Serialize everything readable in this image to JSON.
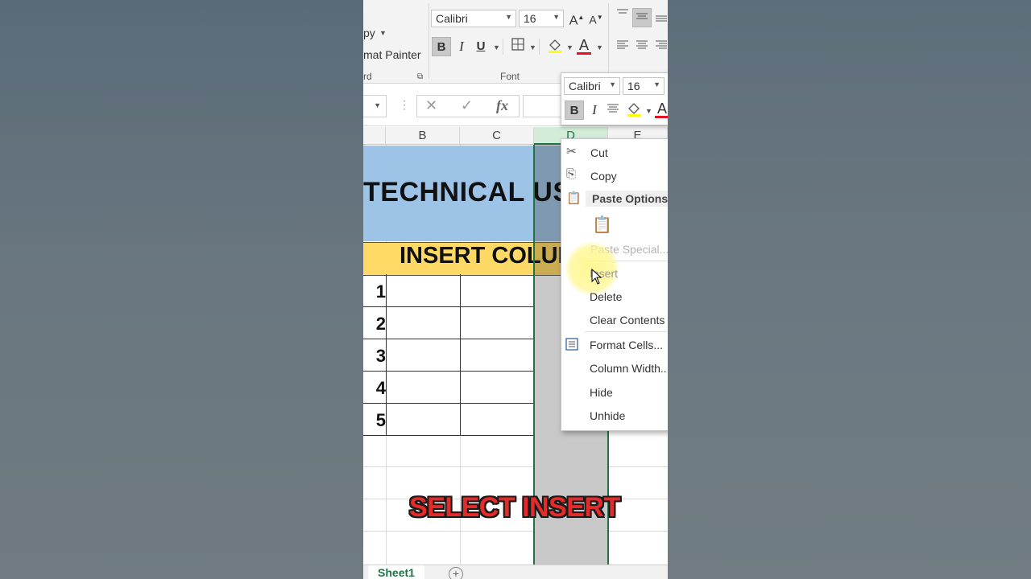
{
  "ribbon": {
    "clipboard": {
      "copy_label": "py",
      "format_painter_label": "mat Painter",
      "group_label": "rd"
    },
    "font": {
      "font_name": "Calibri",
      "font_size": "16",
      "grow_font": "A",
      "shrink_font": "A",
      "bold": "B",
      "italic": "I",
      "underline": "U",
      "font_color": "A",
      "group_label": "Font"
    }
  },
  "formula_bar": {
    "cancel": "✕",
    "enter": "✓",
    "fx": "fx"
  },
  "columns": [
    "B",
    "C",
    "D",
    "E"
  ],
  "sheet": {
    "title": "TECHNICAL US",
    "subtitle": "INSERT COLUM",
    "row_numbers": [
      "1",
      "2",
      "3",
      "4",
      "5"
    ]
  },
  "mini_toolbar": {
    "font_name": "Calibri",
    "font_size": "16",
    "bold": "B",
    "italic": "I",
    "font_color": "A"
  },
  "context_menu": {
    "cut": "Cut",
    "copy": "Copy",
    "paste_options": "Paste Options:",
    "paste_special": "Paste Special...",
    "insert": "Insert",
    "delete": "Delete",
    "clear_contents": "Clear Contents",
    "format_cells": "Format Cells...",
    "column_width": "Column Width...",
    "hide": "Hide",
    "unhide": "Unhide"
  },
  "sheet_tab": "Sheet1",
  "caption": "SELECT INSERT",
  "colors": {
    "excel_green": "#217346",
    "header_blue": "#9dc3e6",
    "header_yellow": "#ffd966",
    "caption_red": "#e52a2a"
  }
}
